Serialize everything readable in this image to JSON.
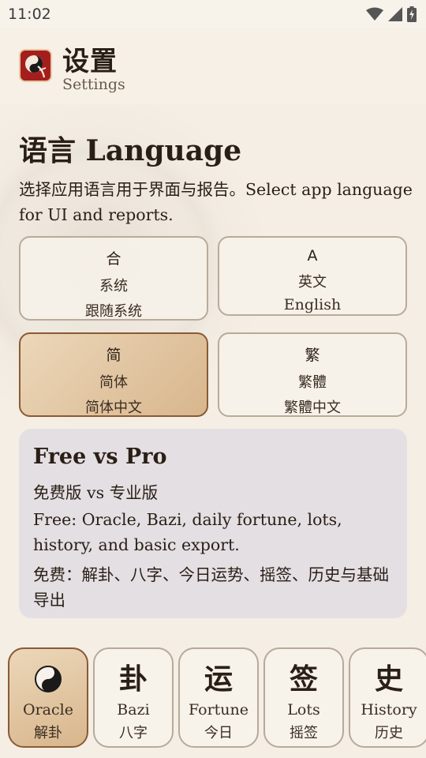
{
  "status_bar": {
    "time": "11:02",
    "icons": [
      "wifi-icon",
      "signal-icon",
      "battery-charging-icon"
    ]
  },
  "header": {
    "title": "设置",
    "subtitle": "Settings",
    "logo_icon": "app-logo-icon"
  },
  "language": {
    "title": "语言 Language",
    "description": "选择应用语言用于界面与报告。Select app language for UI and reports.",
    "options": [
      {
        "glyph": "合",
        "name": "系统",
        "native": "跟随系统",
        "selected": false
      },
      {
        "glyph": "A",
        "name": "英文",
        "native": "English",
        "selected": false
      },
      {
        "glyph": "简",
        "name": "简体",
        "native": "简体中文",
        "selected": true
      },
      {
        "glyph": "繁",
        "name": "繁體",
        "native": "繁體中文",
        "selected": false
      }
    ]
  },
  "pro": {
    "title": "Free vs Pro",
    "subtitle_zh": "免费版 vs 专业版",
    "free_en": "Free: Oracle, Bazi, daily fortune, lots, history, and basic export.",
    "free_zh": "免费：解卦、八字、今日运势、摇签、历史与基础导出"
  },
  "nav": {
    "tabs": [
      {
        "glyph": "☯",
        "label_en": "Oracle",
        "label_zh": "解卦",
        "active": true
      },
      {
        "glyph": "卦",
        "label_en": "Bazi",
        "label_zh": "八字",
        "active": false
      },
      {
        "glyph": "运",
        "label_en": "Fortune",
        "label_zh": "今日",
        "active": false
      },
      {
        "glyph": "签",
        "label_en": "Lots",
        "label_zh": "摇签",
        "active": false
      },
      {
        "glyph": "史",
        "label_en": "History",
        "label_zh": "历史",
        "active": false
      }
    ]
  },
  "colors": {
    "accent": "#8a5a34",
    "selected_fill": "#d8b68d",
    "card_bg": "#e4dfe3",
    "logo_red": "#a51e1e"
  }
}
